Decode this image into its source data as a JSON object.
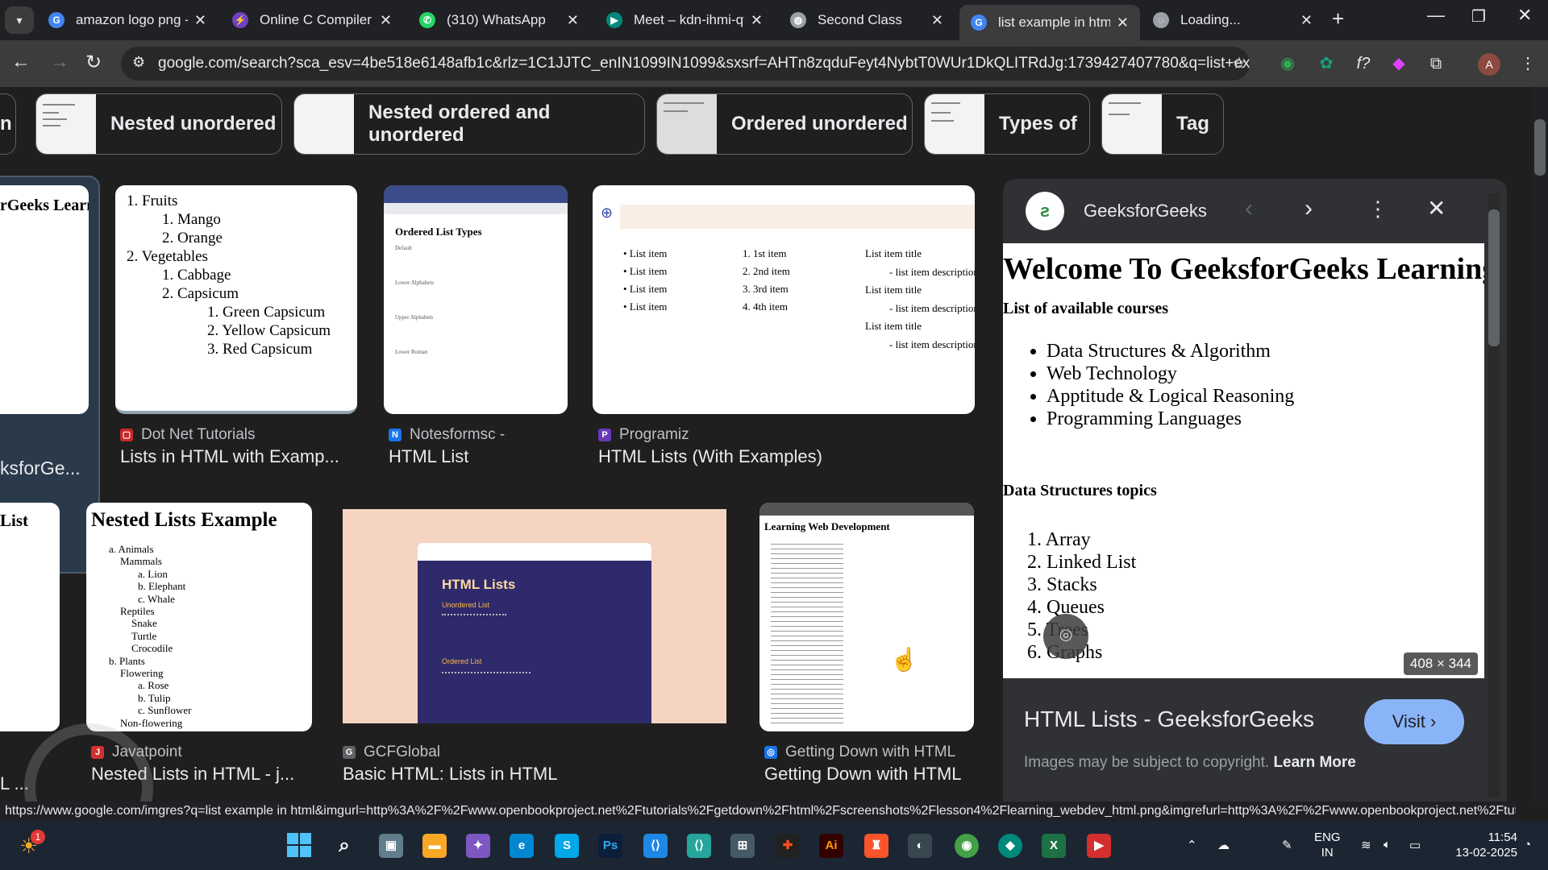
{
  "tabs": [
    {
      "title": "amazon logo png - G",
      "icon": "google-icon",
      "color": "#4285f4",
      "letter": "G"
    },
    {
      "title": "Online C Compiler - (",
      "icon": "compiler-icon",
      "color": "#6f42c1",
      "letter": "⚡"
    },
    {
      "title": "(310) WhatsApp",
      "icon": "whatsapp-icon",
      "color": "#25d366",
      "letter": "✆"
    },
    {
      "title": "Meet – kdn-ihmi-qtr",
      "icon": "meet-icon",
      "color": "#00897b",
      "letter": "▶"
    },
    {
      "title": "Second Class",
      "icon": "globe-icon",
      "color": "#9aa0a6",
      "letter": "◍"
    },
    {
      "title": "list example in html",
      "icon": "google-icon",
      "color": "#4285f4",
      "letter": "G"
    },
    {
      "title": "Loading...",
      "icon": "loading-icon",
      "color": "#9aa0a6",
      "letter": "◌"
    }
  ],
  "address": {
    "url": "google.com/search?sca_esv=4be518e6148afb1c&rlz=1C1JJTC_enIN1099IN1099&sxsrf=AHTn8zqduFeyt4NybtT0WUr1DkQLITRdJg:1739427407780&q=list+example+in+..."
  },
  "profile_letter": "A",
  "chips": [
    "Nested unordered",
    "Nested ordered and unordered",
    "Ordered unordered",
    "Types of",
    "Tag"
  ],
  "row1": [
    {
      "source": "Dot Net Tutorials",
      "title": "Lists in HTML with Examp...",
      "icon_color": "#c62828"
    },
    {
      "source": "Notesformsc -",
      "title": "HTML List",
      "icon_color": "#1a73e8"
    },
    {
      "source": "Programiz",
      "title": "HTML Lists (With Examples)",
      "icon_color": "#673ab7"
    }
  ],
  "row1_partial": {
    "title": "ksforGe...",
    "heading": "rGeeks Learn"
  },
  "row2": [
    {
      "source": "Javatpoint",
      "title": "Nested Lists in HTML - j...",
      "icon_color": "#d32f2f"
    },
    {
      "source": "GCFGlobal",
      "title": "Basic HTML: Lists in HTML",
      "icon_color": "#5f6368"
    },
    {
      "source": "Getting Down with HTML",
      "title": "Getting Down with HTML",
      "icon_color": "#1a73e8"
    }
  ],
  "row2_partial": {
    "heading": "List",
    "title": "L ..."
  },
  "thumb_dotnet": [
    "1. Fruits",
    "1. Mango",
    "2. Orange",
    "2. Vegetables",
    "1. Cabbage",
    "2. Capsicum",
    "1. Green Capsicum",
    "2. Yellow Capsicum",
    "3. Red Capsicum"
  ],
  "thumb_notes": {
    "heading": "Ordered List Types",
    "groups": [
      "Default",
      "Lower Alphabets",
      "Upper Alphabets",
      "Lower Roman"
    ]
  },
  "thumb_programiz": {
    "ul": [
      "List item",
      "List item",
      "List item",
      "List item"
    ],
    "ol": [
      "1st item",
      "2nd item",
      "3rd item",
      "4th item"
    ],
    "dl_title": "List item title",
    "dl_desc": "- list item description"
  },
  "thumb_javatpoint": {
    "heading": "Nested Lists Example",
    "items": [
      "a. Animals",
      "Mammals",
      "a. Lion",
      "b. Elephant",
      "c. Whale",
      "Reptiles",
      "Snake",
      "Turtle",
      "Crocodile",
      "b. Plants",
      "Flowering",
      "a. Rose",
      "b. Tulip",
      "c. Sunflower",
      "Non-flowering"
    ]
  },
  "thumb_gcf": {
    "heading": "HTML Lists",
    "sub1": "Unordered List",
    "sub2": "Ordered List"
  },
  "thumb_getting": {
    "heading": "Learning Web Development"
  },
  "panel": {
    "site": "GeeksforGeeks",
    "heading": "Welcome To GeeksforGeeks Learning",
    "courses_label": "List of available courses",
    "courses": [
      "Data Structures & Algorithm",
      "Web Technology",
      "Apptitude & Logical Reasoning",
      "Programming Languages"
    ],
    "topics_label": "Data Structures topics",
    "topics": [
      "1. Array",
      "2. Linked List",
      "3. Stacks",
      "4. Queues",
      "5. Trees",
      "6. Graphs"
    ],
    "dims": "408 × 344",
    "title": "HTML Lists - GeeksforGeeks",
    "visit": "Visit",
    "copyright": "Images may be subject to copyright.",
    "learn_more": "Learn More"
  },
  "status_url": "https://www.google.com/imgres?q=list example in html&imgurl=http%3A%2F%2Fwww.openbookproject.net%2Ftutorials%2Fgetdown%2Fhtml%2Fscreenshots%2Flesson4%2Flearning_webdev_html.png&imgrefurl=http%3A%2F%2Fwww.openbookproject.net%2Ftutorials%2Fgetdo...",
  "taskbar": {
    "lang1": "ENG",
    "lang2": "IN",
    "time": "11:54",
    "date": "13-02-2025",
    "badge": "1"
  }
}
